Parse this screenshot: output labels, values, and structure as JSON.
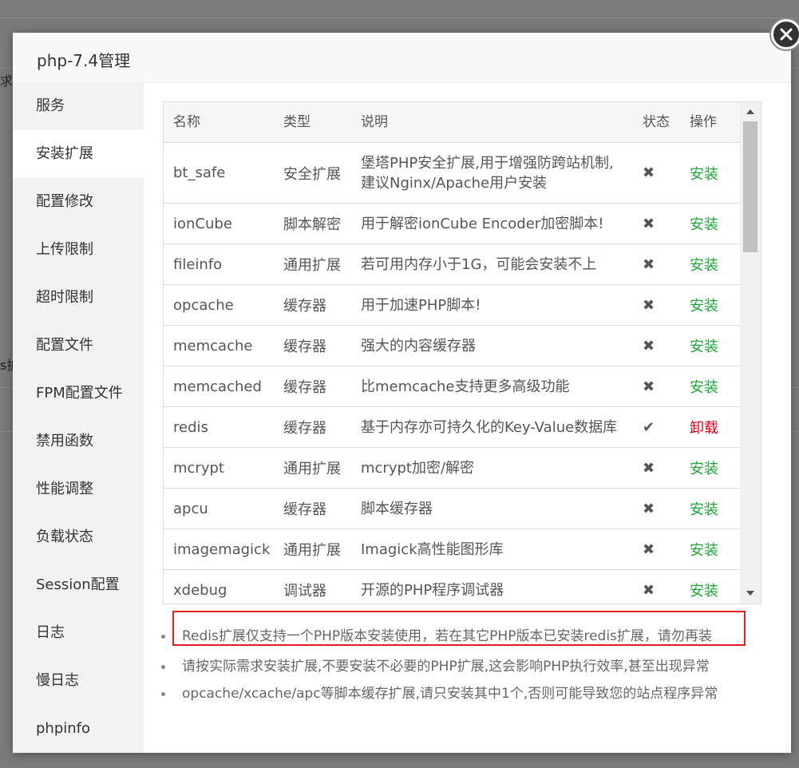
{
  "modal": {
    "title": "php-7.4管理"
  },
  "background_fragments": [
    "求,",
    "s扩"
  ],
  "sidebar": {
    "items": [
      {
        "label": "服务"
      },
      {
        "label": "安装扩展",
        "active": true
      },
      {
        "label": "配置修改"
      },
      {
        "label": "上传限制"
      },
      {
        "label": "超时限制"
      },
      {
        "label": "配置文件"
      },
      {
        "label": "FPM配置文件"
      },
      {
        "label": "禁用函数"
      },
      {
        "label": "性能调整"
      },
      {
        "label": "负载状态"
      },
      {
        "label": "Session配置"
      },
      {
        "label": "日志"
      },
      {
        "label": "慢日志"
      },
      {
        "label": "phpinfo"
      }
    ]
  },
  "table": {
    "headers": {
      "name": "名称",
      "type": "类型",
      "desc": "说明",
      "status": "状态",
      "action": "操作"
    },
    "rows": [
      {
        "name": "bt_safe",
        "type": "安全扩展",
        "desc": "堡塔PHP安全扩展,用于增强防跨站机制,\n建议Nginx/Apache用户安装",
        "status": "✖",
        "installed": false,
        "action": "安装"
      },
      {
        "name": "ionCube",
        "type": "脚本解密",
        "desc": "用于解密ionCube Encoder加密脚本!",
        "status": "✖",
        "installed": false,
        "action": "安装"
      },
      {
        "name": "fileinfo",
        "type": "通用扩展",
        "desc": "若可用内存小于1G，可能会安装不上",
        "status": "✖",
        "installed": false,
        "action": "安装"
      },
      {
        "name": "opcache",
        "type": "缓存器",
        "desc": "用于加速PHP脚本!",
        "status": "✖",
        "installed": false,
        "action": "安装"
      },
      {
        "name": "memcache",
        "type": "缓存器",
        "desc": "强大的内容缓存器",
        "status": "✖",
        "installed": false,
        "action": "安装"
      },
      {
        "name": "memcached",
        "type": "缓存器",
        "desc": "比memcache支持更多高级功能",
        "status": "✖",
        "installed": false,
        "action": "安装"
      },
      {
        "name": "redis",
        "type": "缓存器",
        "desc": "基于内存亦可持久化的Key-Value数据库",
        "status": "✔",
        "installed": true,
        "action": "卸载"
      },
      {
        "name": "mcrypt",
        "type": "通用扩展",
        "desc": "mcrypt加密/解密",
        "status": "✖",
        "installed": false,
        "action": "安装"
      },
      {
        "name": "apcu",
        "type": "缓存器",
        "desc": "脚本缓存器",
        "status": "✖",
        "installed": false,
        "action": "安装"
      },
      {
        "name": "imagemagick",
        "type": "通用扩展",
        "desc": "Imagick高性能图形库",
        "status": "✖",
        "installed": false,
        "action": "安装"
      },
      {
        "name": "xdebug",
        "type": "调试器",
        "desc": "开源的PHP程序调试器",
        "status": "✖",
        "installed": false,
        "action": "安装"
      }
    ]
  },
  "notes": [
    "Redis扩展仅支持一个PHP版本安装使用，若在其它PHP版本已安装redis扩展，请勿再装",
    "请按实际需求安装扩展,不要安装不必要的PHP扩展,这会影响PHP执行效率,甚至出现异常",
    "opcache/xcache/apc等脚本缓存扩展,请只安装其中1个,否则可能导致您的站点程序异常"
  ],
  "colors": {
    "install": "#20a53a",
    "uninstall": "#d9001b",
    "highlight": "#e02020"
  }
}
